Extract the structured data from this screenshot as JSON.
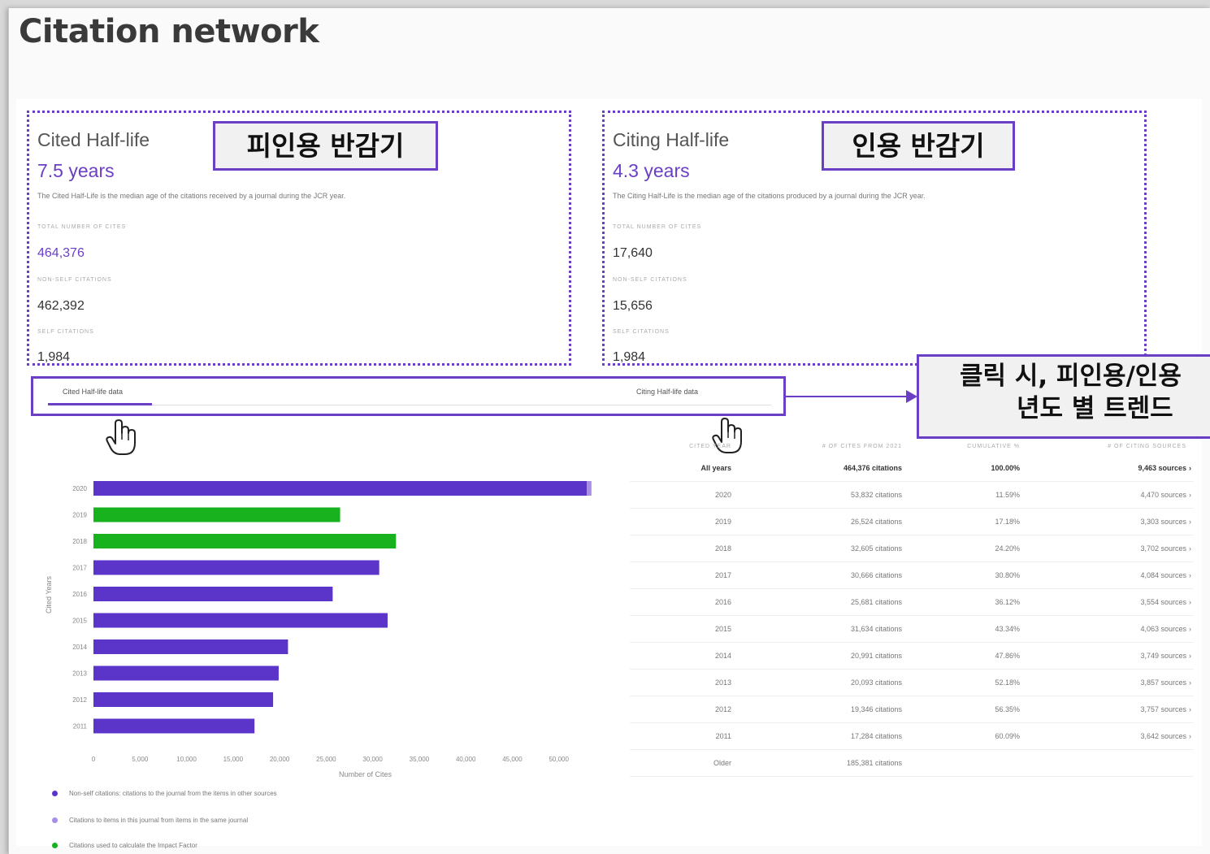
{
  "page_title": "Citation network",
  "cited": {
    "title": "Cited Half-life",
    "value": "7.5 years",
    "description": "The Cited Half-Life is the median age of the citations received by a journal during the JCR year.",
    "stats": [
      {
        "label": "TOTAL NUMBER OF CITES",
        "value": "464,376"
      },
      {
        "label": "NON-SELF CITATIONS",
        "value": "462,392"
      },
      {
        "label": "SELF CITATIONS",
        "value": "1,984"
      }
    ]
  },
  "citing": {
    "title": "Citing Half-life",
    "value": "4.3 years",
    "description": "The Citing Half-Life is the median age of the citations produced by a journal during the JCR year.",
    "stats": [
      {
        "label": "TOTAL NUMBER OF CITES",
        "value": "17,640"
      },
      {
        "label": "NON-SELF CITATIONS",
        "value": "15,656"
      },
      {
        "label": "SELF CITATIONS",
        "value": "1,984"
      }
    ]
  },
  "callouts": {
    "cited": "피인용 반감기",
    "citing": "인용 반감기",
    "trend_line1": "클릭 시, 피인용/인용",
    "trend_line2": "년도 별 트렌드"
  },
  "tabs": {
    "cited": "Cited Half-life data",
    "citing": "Citing Half-life data"
  },
  "colors": {
    "purple": "#5b35c9",
    "green": "#19b21f",
    "lavender": "#a88ee8",
    "accent": "#6a3fc6"
  },
  "chart_data": {
    "type": "bar",
    "orientation": "horizontal",
    "categories": [
      "2020",
      "2019",
      "2018",
      "2017",
      "2016",
      "2015",
      "2014",
      "2013",
      "2012",
      "2011"
    ],
    "series": [
      {
        "name": "Non-self citations: citations to the journal from the items in other sources",
        "values": [
          53000,
          0,
          0,
          30700,
          25700,
          31600,
          20900,
          19900,
          19300,
          17300
        ]
      },
      {
        "name": "Citations to items in this journal from items in the same journal",
        "values": [
          500,
          0,
          0,
          0,
          0,
          0,
          0,
          0,
          0,
          0
        ]
      },
      {
        "name": "Citations used to calculate the Impact Factor",
        "values": [
          0,
          26500,
          32500,
          0,
          0,
          0,
          0,
          0,
          0,
          0
        ]
      }
    ],
    "xlim": [
      0,
      55000
    ],
    "xticks": [
      "0",
      "5,000",
      "10,000",
      "15,000",
      "20,000",
      "25,000",
      "30,000",
      "35,000",
      "40,000",
      "45,000",
      "50,000"
    ],
    "xlabel": "Number of Cites",
    "ylabel": "Cited Years"
  },
  "table": {
    "headers": [
      "CITED YEAR",
      "# OF CITES FROM 2021",
      "CUMULATIVE %",
      "# OF CITING SOURCES"
    ],
    "rows": [
      {
        "year": "All years",
        "cites": "464,376 citations",
        "cum": "100.00%",
        "sources": "9,463 sources",
        "bold": true
      },
      {
        "year": "2020",
        "cites": "53,832 citations",
        "cum": "11.59%",
        "sources": "4,470 sources"
      },
      {
        "year": "2019",
        "cites": "26,524 citations",
        "cum": "17.18%",
        "sources": "3,303 sources"
      },
      {
        "year": "2018",
        "cites": "32,605 citations",
        "cum": "24.20%",
        "sources": "3,702 sources"
      },
      {
        "year": "2017",
        "cites": "30,666 citations",
        "cum": "30.80%",
        "sources": "4,084 sources"
      },
      {
        "year": "2016",
        "cites": "25,681 citations",
        "cum": "36.12%",
        "sources": "3,554 sources"
      },
      {
        "year": "2015",
        "cites": "31,634 citations",
        "cum": "43.34%",
        "sources": "4,063 sources"
      },
      {
        "year": "2014",
        "cites": "20,991 citations",
        "cum": "47.86%",
        "sources": "3,749 sources"
      },
      {
        "year": "2013",
        "cites": "20,093 citations",
        "cum": "52.18%",
        "sources": "3,857 sources"
      },
      {
        "year": "2012",
        "cites": "19,346 citations",
        "cum": "56.35%",
        "sources": "3,757 sources"
      },
      {
        "year": "2011",
        "cites": "17,284 citations",
        "cum": "60.09%",
        "sources": "3,642 sources"
      },
      {
        "year": "Older",
        "cites": "185,381 citations",
        "cum": "",
        "sources": ""
      }
    ]
  }
}
